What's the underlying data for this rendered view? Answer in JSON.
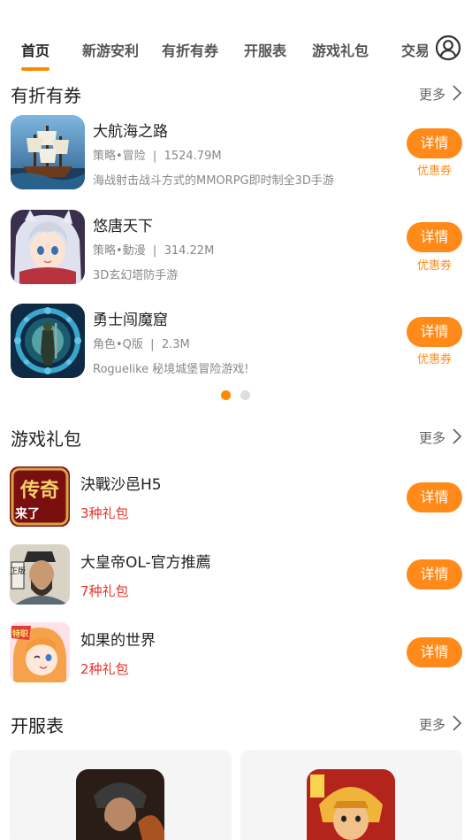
{
  "tabs": [
    {
      "label": "首页",
      "active": true
    },
    {
      "label": "新游安利",
      "active": false
    },
    {
      "label": "有折有券",
      "active": false
    },
    {
      "label": "开服表",
      "active": false
    },
    {
      "label": "游戏礼包",
      "active": false
    },
    {
      "label": "交易",
      "active": false
    }
  ],
  "avatar_icon": "user-circle-icon",
  "discount": {
    "title": "有折有券",
    "more": "更多",
    "games": [
      {
        "name": "大航海之路",
        "category": "策略•冒险",
        "size": "1524.79M",
        "desc": "海战射击战斗方式的MMORPG即时制全3D手游",
        "button": "详情",
        "tag": "优惠券"
      },
      {
        "name": "悠唐天下",
        "category": "策略•動漫",
        "size": "314.22M",
        "desc": "3D玄幻塔防手游",
        "button": "详情",
        "tag": "优惠券"
      },
      {
        "name": "勇士闯魔窟",
        "category": "角色•Q版",
        "size": "2.3M",
        "desc": "Roguelike 秘境城堡冒险游戏!",
        "button": "详情",
        "tag": "优惠券"
      }
    ],
    "pager": {
      "current": 1,
      "total": 2
    }
  },
  "gifts": {
    "title": "游戏礼包",
    "more": "更多",
    "items": [
      {
        "name": "決戰沙邑H5",
        "count": "3种礼包",
        "button": "详情"
      },
      {
        "name": "大皇帝OL-官方推薦",
        "count": "7种礼包",
        "button": "详情"
      },
      {
        "name": "如果的世界",
        "count": "2种礼包",
        "button": "详情"
      }
    ]
  },
  "servers": {
    "title": "开服表",
    "more": "更多"
  },
  "colors": {
    "accent": "#ff8a1a",
    "gift_count": "#e8332a",
    "dot_active": "#ff8a00",
    "dot_inactive": "#dddddd"
  },
  "icon_logo_text": {
    "gift1_logo": "传奇",
    "gift1_logo2": "来了",
    "gift2_stamp": "正版",
    "gift3_badge": "特职"
  }
}
